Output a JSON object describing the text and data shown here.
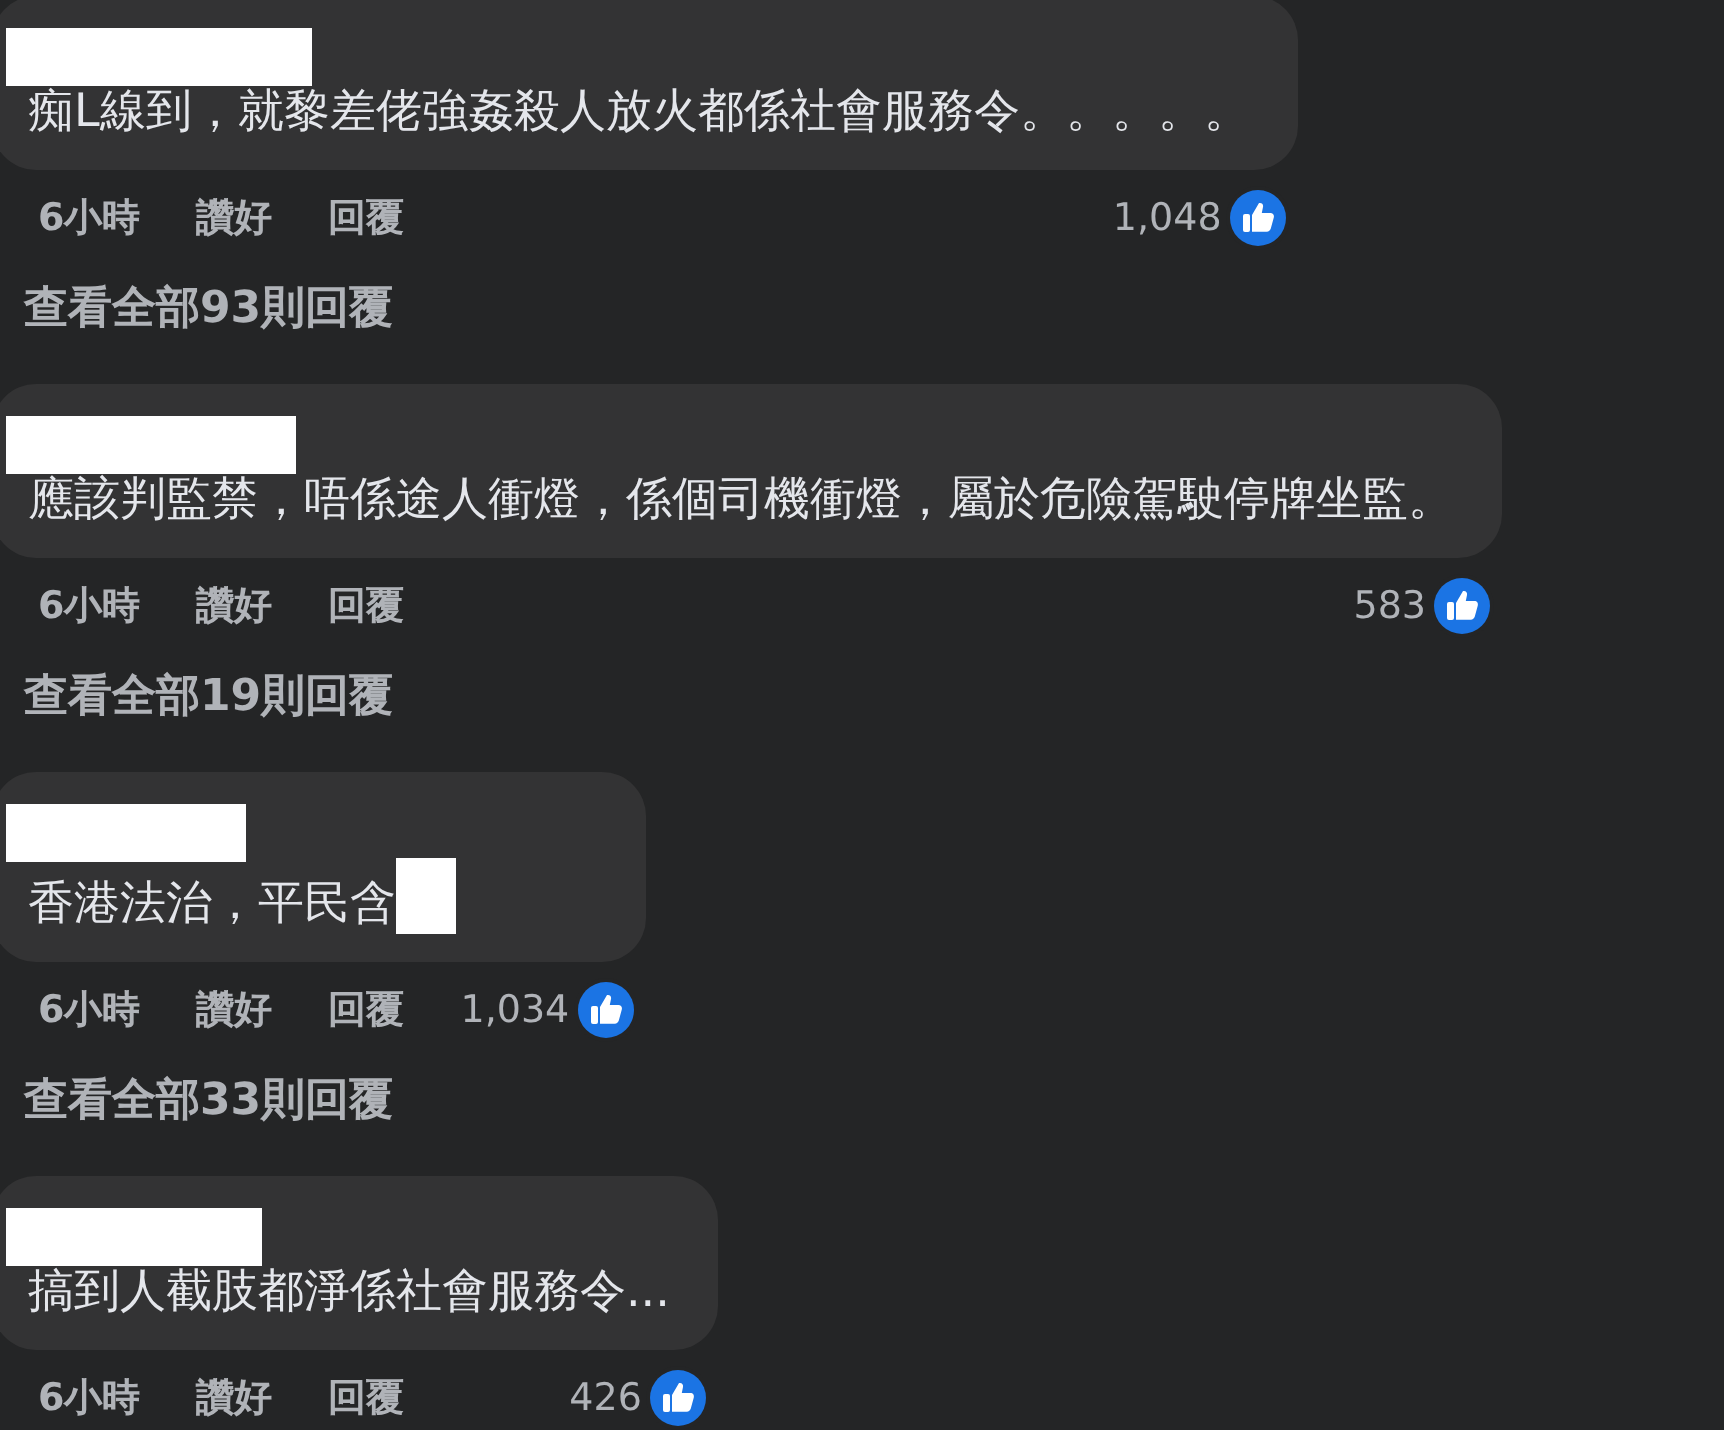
{
  "comments": [
    {
      "text": "痴L線到，就黎差佬強姦殺人放火都係社會服務令。。。。。",
      "trailing_redaction": false,
      "time": "6小時",
      "like_label": "讚好",
      "reply_label": "回覆",
      "reaction_count": "1,048",
      "view_replies": "查看全部93則回覆"
    },
    {
      "text": "應該判監禁，唔係途人衝燈，係個司機衝燈，屬於危險駕駛停牌坐監。",
      "trailing_redaction": false,
      "time": "6小時",
      "like_label": "讚好",
      "reply_label": "回覆",
      "reaction_count": "583",
      "view_replies": "查看全部19則回覆"
    },
    {
      "text": "香港法治，平民含",
      "trailing_redaction": true,
      "time": "6小時",
      "like_label": "讚好",
      "reply_label": "回覆",
      "reaction_count": "1,034",
      "view_replies": "查看全部33則回覆"
    },
    {
      "text": "搞到人截肢都淨係社會服務令...",
      "trailing_redaction": false,
      "time": "6小時",
      "like_label": "讚好",
      "reply_label": "回覆",
      "reaction_count": "426"
    }
  ]
}
